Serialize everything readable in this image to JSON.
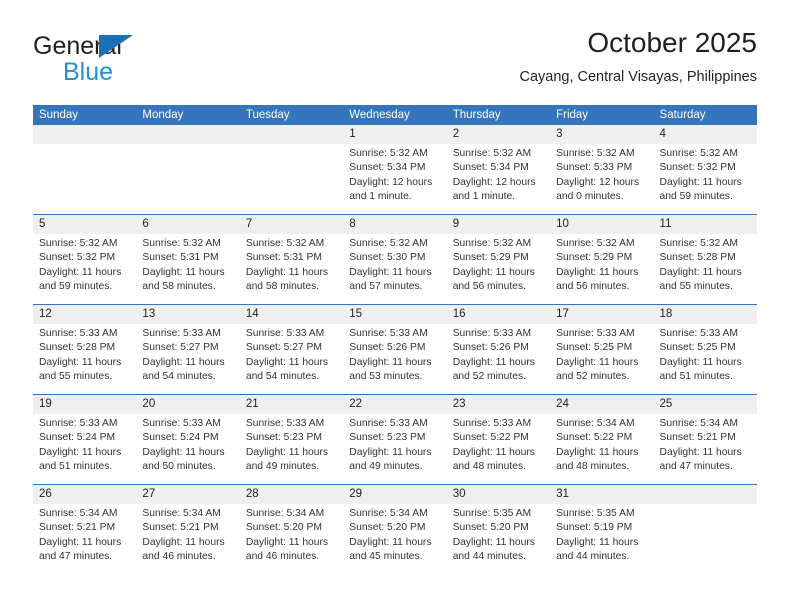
{
  "brand": {
    "word1": "General",
    "word2": "Blue",
    "triangle_color": "#1b70b8",
    "blue_text_color": "#2291d0"
  },
  "header": {
    "title": "October 2025",
    "location": "Cayang, Central Visayas, Philippines"
  },
  "theme": {
    "header_bar_color": "#3575bb",
    "number_band_color": "#efefef",
    "week_rule_color": "#3575bb"
  },
  "calendar": {
    "weekday_headers": [
      "Sunday",
      "Monday",
      "Tuesday",
      "Wednesday",
      "Thursday",
      "Friday",
      "Saturday"
    ],
    "labels": {
      "sunrise": "Sunrise:",
      "sunset": "Sunset:",
      "daylight": "Daylight:"
    },
    "weeks": [
      {
        "numbers": [
          "",
          "",
          "",
          "1",
          "2",
          "3",
          "4"
        ],
        "cells": [
          {},
          {},
          {},
          {
            "sunrise": "Sunrise: 5:32 AM",
            "sunset": "Sunset: 5:34 PM",
            "daylight": "Daylight: 12 hours and 1 minute."
          },
          {
            "sunrise": "Sunrise: 5:32 AM",
            "sunset": "Sunset: 5:34 PM",
            "daylight": "Daylight: 12 hours and 1 minute."
          },
          {
            "sunrise": "Sunrise: 5:32 AM",
            "sunset": "Sunset: 5:33 PM",
            "daylight": "Daylight: 12 hours and 0 minutes."
          },
          {
            "sunrise": "Sunrise: 5:32 AM",
            "sunset": "Sunset: 5:32 PM",
            "daylight": "Daylight: 11 hours and 59 minutes."
          }
        ]
      },
      {
        "numbers": [
          "5",
          "6",
          "7",
          "8",
          "9",
          "10",
          "11"
        ],
        "cells": [
          {
            "sunrise": "Sunrise: 5:32 AM",
            "sunset": "Sunset: 5:32 PM",
            "daylight": "Daylight: 11 hours and 59 minutes."
          },
          {
            "sunrise": "Sunrise: 5:32 AM",
            "sunset": "Sunset: 5:31 PM",
            "daylight": "Daylight: 11 hours and 58 minutes."
          },
          {
            "sunrise": "Sunrise: 5:32 AM",
            "sunset": "Sunset: 5:31 PM",
            "daylight": "Daylight: 11 hours and 58 minutes."
          },
          {
            "sunrise": "Sunrise: 5:32 AM",
            "sunset": "Sunset: 5:30 PM",
            "daylight": "Daylight: 11 hours and 57 minutes."
          },
          {
            "sunrise": "Sunrise: 5:32 AM",
            "sunset": "Sunset: 5:29 PM",
            "daylight": "Daylight: 11 hours and 56 minutes."
          },
          {
            "sunrise": "Sunrise: 5:32 AM",
            "sunset": "Sunset: 5:29 PM",
            "daylight": "Daylight: 11 hours and 56 minutes."
          },
          {
            "sunrise": "Sunrise: 5:32 AM",
            "sunset": "Sunset: 5:28 PM",
            "daylight": "Daylight: 11 hours and 55 minutes."
          }
        ]
      },
      {
        "numbers": [
          "12",
          "13",
          "14",
          "15",
          "16",
          "17",
          "18"
        ],
        "cells": [
          {
            "sunrise": "Sunrise: 5:33 AM",
            "sunset": "Sunset: 5:28 PM",
            "daylight": "Daylight: 11 hours and 55 minutes."
          },
          {
            "sunrise": "Sunrise: 5:33 AM",
            "sunset": "Sunset: 5:27 PM",
            "daylight": "Daylight: 11 hours and 54 minutes."
          },
          {
            "sunrise": "Sunrise: 5:33 AM",
            "sunset": "Sunset: 5:27 PM",
            "daylight": "Daylight: 11 hours and 54 minutes."
          },
          {
            "sunrise": "Sunrise: 5:33 AM",
            "sunset": "Sunset: 5:26 PM",
            "daylight": "Daylight: 11 hours and 53 minutes."
          },
          {
            "sunrise": "Sunrise: 5:33 AM",
            "sunset": "Sunset: 5:26 PM",
            "daylight": "Daylight: 11 hours and 52 minutes."
          },
          {
            "sunrise": "Sunrise: 5:33 AM",
            "sunset": "Sunset: 5:25 PM",
            "daylight": "Daylight: 11 hours and 52 minutes."
          },
          {
            "sunrise": "Sunrise: 5:33 AM",
            "sunset": "Sunset: 5:25 PM",
            "daylight": "Daylight: 11 hours and 51 minutes."
          }
        ]
      },
      {
        "numbers": [
          "19",
          "20",
          "21",
          "22",
          "23",
          "24",
          "25"
        ],
        "cells": [
          {
            "sunrise": "Sunrise: 5:33 AM",
            "sunset": "Sunset: 5:24 PM",
            "daylight": "Daylight: 11 hours and 51 minutes."
          },
          {
            "sunrise": "Sunrise: 5:33 AM",
            "sunset": "Sunset: 5:24 PM",
            "daylight": "Daylight: 11 hours and 50 minutes."
          },
          {
            "sunrise": "Sunrise: 5:33 AM",
            "sunset": "Sunset: 5:23 PM",
            "daylight": "Daylight: 11 hours and 49 minutes."
          },
          {
            "sunrise": "Sunrise: 5:33 AM",
            "sunset": "Sunset: 5:23 PM",
            "daylight": "Daylight: 11 hours and 49 minutes."
          },
          {
            "sunrise": "Sunrise: 5:33 AM",
            "sunset": "Sunset: 5:22 PM",
            "daylight": "Daylight: 11 hours and 48 minutes."
          },
          {
            "sunrise": "Sunrise: 5:34 AM",
            "sunset": "Sunset: 5:22 PM",
            "daylight": "Daylight: 11 hours and 48 minutes."
          },
          {
            "sunrise": "Sunrise: 5:34 AM",
            "sunset": "Sunset: 5:21 PM",
            "daylight": "Daylight: 11 hours and 47 minutes."
          }
        ]
      },
      {
        "numbers": [
          "26",
          "27",
          "28",
          "29",
          "30",
          "31",
          ""
        ],
        "cells": [
          {
            "sunrise": "Sunrise: 5:34 AM",
            "sunset": "Sunset: 5:21 PM",
            "daylight": "Daylight: 11 hours and 47 minutes."
          },
          {
            "sunrise": "Sunrise: 5:34 AM",
            "sunset": "Sunset: 5:21 PM",
            "daylight": "Daylight: 11 hours and 46 minutes."
          },
          {
            "sunrise": "Sunrise: 5:34 AM",
            "sunset": "Sunset: 5:20 PM",
            "daylight": "Daylight: 11 hours and 46 minutes."
          },
          {
            "sunrise": "Sunrise: 5:34 AM",
            "sunset": "Sunset: 5:20 PM",
            "daylight": "Daylight: 11 hours and 45 minutes."
          },
          {
            "sunrise": "Sunrise: 5:35 AM",
            "sunset": "Sunset: 5:20 PM",
            "daylight": "Daylight: 11 hours and 44 minutes."
          },
          {
            "sunrise": "Sunrise: 5:35 AM",
            "sunset": "Sunset: 5:19 PM",
            "daylight": "Daylight: 11 hours and 44 minutes."
          },
          {}
        ]
      }
    ]
  }
}
